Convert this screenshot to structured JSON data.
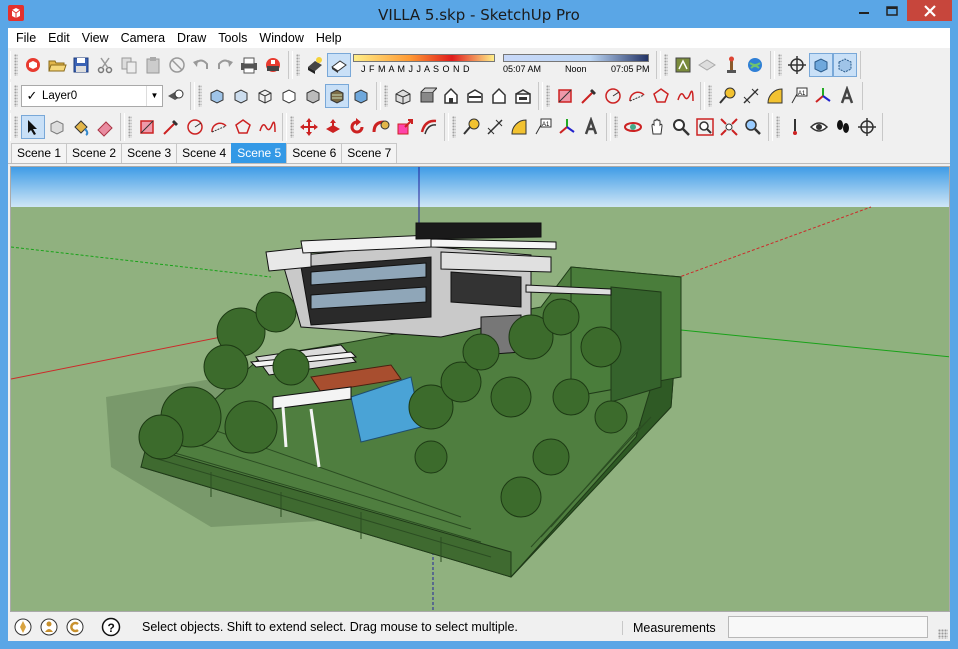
{
  "window": {
    "title": "VILLA 5.skp - SketchUp Pro",
    "app_icon": "sketchup-logo-icon",
    "controls": [
      "minimize-icon",
      "maximize-icon",
      "close-icon"
    ]
  },
  "menubar": {
    "items": [
      "File",
      "Edit",
      "View",
      "Camera",
      "Draw",
      "Tools",
      "Window",
      "Help"
    ]
  },
  "toolbar_row1": {
    "standard": [
      "new-icon",
      "open-icon",
      "save-icon",
      "cut-icon",
      "copy-icon",
      "paste-icon",
      "erase-icon",
      "undo-icon",
      "redo-icon",
      "print-icon",
      "model-info-icon"
    ],
    "shadow_toggles": [
      "shadows-toggle-icon",
      "fog-toggle-icon"
    ],
    "shadow_months": "J F M A M J J A S O N D",
    "time_start": "05:07 AM",
    "time_noon": "Noon",
    "time_end": "07:05 PM",
    "extras": [
      "3d-warehouse-icon",
      "extension-icon",
      "components-icon",
      "geo-location-icon"
    ],
    "views": [
      "section-plane-icon",
      "xray-icon",
      "back-edges-icon"
    ]
  },
  "toolbar_row2": {
    "layer": {
      "selected": "Layer0",
      "check": "✓"
    },
    "layer_manager_icon": "layer-manager-icon",
    "styles": [
      "xray-style-icon",
      "back-edges-style-icon",
      "wireframe-icon",
      "hidden-line-icon",
      "shaded-icon",
      "shaded-textures-icon",
      "monochrome-icon"
    ],
    "views": [
      "iso-view-icon",
      "top-view-icon",
      "front-view-icon",
      "right-view-icon",
      "back-view-icon",
      "left-view-icon"
    ],
    "drawing": [
      "rectangle-icon",
      "line-icon",
      "circle-icon",
      "arc-icon",
      "polygon-icon",
      "freehand-icon"
    ],
    "construction": [
      "tape-measure-icon",
      "dimension-icon",
      "protractor-icon",
      "text-icon",
      "axes-icon",
      "3d-text-icon"
    ]
  },
  "toolbar_row3": {
    "tools": [
      "select-icon",
      "make-component-icon",
      "paint-bucket-icon",
      "eraser-icon",
      "rectangle-icon",
      "line-icon",
      "circle-icon",
      "arc-icon",
      "polygon-icon",
      "freehand-icon",
      "move-icon",
      "push-pull-icon",
      "rotate-icon",
      "follow-me-icon",
      "scale-icon",
      "offset-icon",
      "tape-measure-icon",
      "dimension-icon",
      "protractor-icon",
      "text-icon",
      "axes-icon",
      "3d-text-icon",
      "orbit-icon",
      "pan-icon",
      "zoom-icon",
      "zoom-window-icon",
      "zoom-extents-icon",
      "previous-view-icon",
      "position-camera-icon",
      "look-around-icon",
      "walk-icon",
      "section-plane-icon"
    ]
  },
  "scenes": {
    "tabs": [
      "Scene 1",
      "Scene 2",
      "Scene 3",
      "Scene 4",
      "Scene 5",
      "Scene 6",
      "Scene 7"
    ],
    "active": "Scene 5"
  },
  "statusbar": {
    "icons": [
      "geo-location-icon",
      "credits-icon",
      "copyright-icon",
      "help-icon"
    ],
    "hint": "Select objects. Shift to extend select. Drag mouse to select multiple.",
    "measurements_label": "Measurements",
    "measurements_value": ""
  },
  "colors": {
    "window_frame": "#5aa6e6",
    "sky_top": "#4aa3e8",
    "ground": "#8fb07e",
    "active_tab": "#3399e6",
    "close_button": "#c7463c"
  }
}
